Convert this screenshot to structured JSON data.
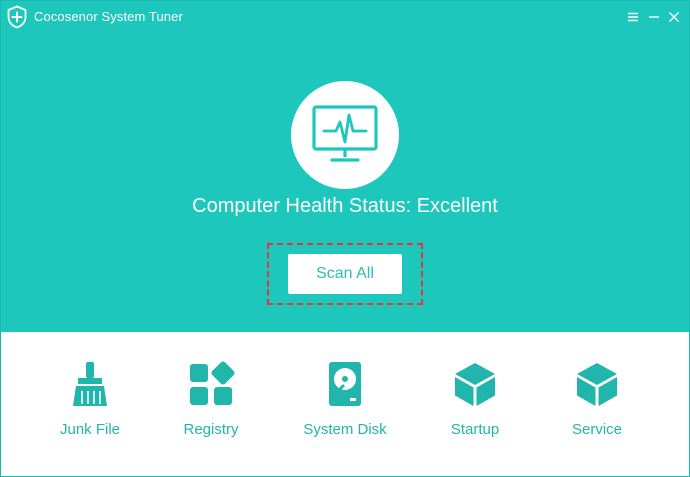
{
  "app": {
    "title": "Cocosenor System Tuner",
    "logo_icon": "shield-plus-icon"
  },
  "window_controls": [
    {
      "name": "menu-icon"
    },
    {
      "name": "minimize-icon"
    },
    {
      "name": "close-icon"
    }
  ],
  "hero": {
    "icon": "monitor-heartbeat-icon",
    "status_text": "Computer Health Status: Excellent",
    "scan_button_label": "Scan All"
  },
  "tools": [
    {
      "label": "Junk File",
      "icon": "broom-icon"
    },
    {
      "label": "Registry",
      "icon": "registry-blocks-icon"
    },
    {
      "label": "System Disk",
      "icon": "hard-disk-icon"
    },
    {
      "label": "Startup",
      "icon": "cube-icon"
    },
    {
      "label": "Service",
      "icon": "cube-icon"
    }
  ],
  "colors": {
    "accent": "#1ec7bc",
    "icon": "#22b5ab",
    "highlight": "#e5373a"
  }
}
